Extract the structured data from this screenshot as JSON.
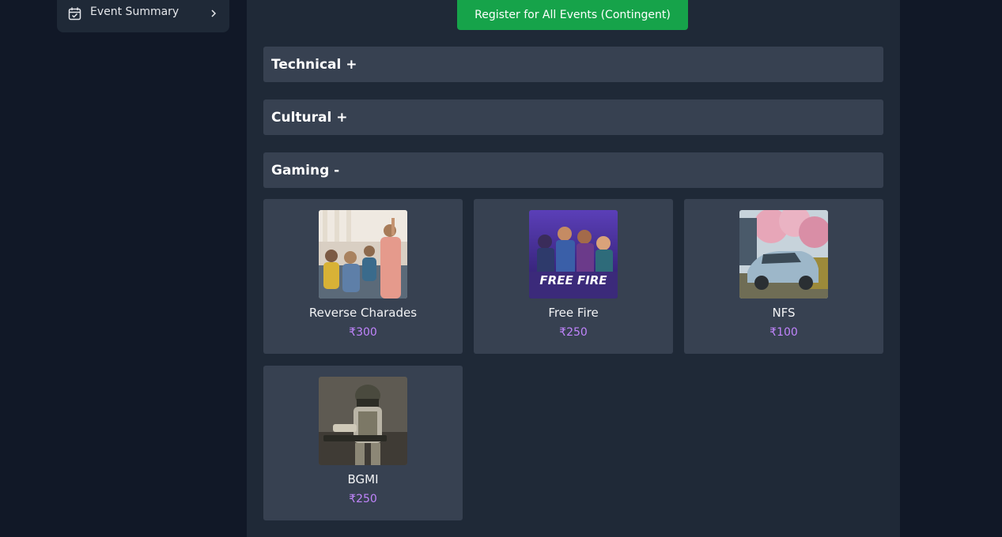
{
  "sidebar": {
    "items": [
      {
        "label": "Event Summary",
        "icon": "calendar-check-icon",
        "trailing_icon": "chevron-right-icon"
      }
    ]
  },
  "main": {
    "register_all_label": "Register for All Events (Contingent)",
    "register_color": "#16a34a",
    "sections": [
      {
        "label": "Technical +",
        "expanded": false
      },
      {
        "label": "Cultural +",
        "expanded": false
      },
      {
        "label": "Gaming -",
        "expanded": true
      }
    ],
    "events": [
      {
        "name": "Reverse Charades",
        "price": "₹300",
        "image": "people-group-photo"
      },
      {
        "name": "Free Fire",
        "price": "₹250",
        "image": "free-fire-game-art",
        "image_text": "FREE FIRE"
      },
      {
        "name": "NFS",
        "price": "₹100",
        "image": "silver-sports-car-photo"
      },
      {
        "name": "BGMI",
        "price": "₹250",
        "image": "soldier-with-helmet-photo"
      }
    ],
    "price_color": "#c084fc"
  }
}
